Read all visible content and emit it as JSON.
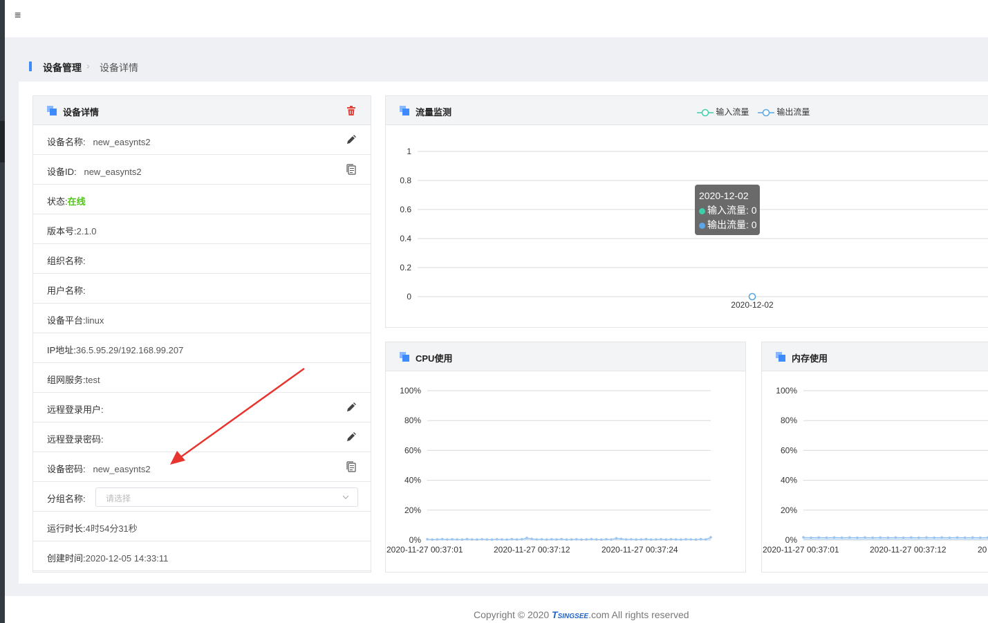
{
  "breadcrumb": {
    "root": "设备管理",
    "current": "设备详情"
  },
  "detail": {
    "title": "设备详情",
    "rows": {
      "name": {
        "label": "设备名称:",
        "value": "new_easynts2"
      },
      "id": {
        "label": "设备ID:",
        "value": "new_easynts2"
      },
      "status": {
        "label": "状态:",
        "value": "在线"
      },
      "version": {
        "label": "版本号:",
        "value": "2.1.0"
      },
      "org": {
        "label": "组织名称:",
        "value": ""
      },
      "user": {
        "label": "用户名称:",
        "value": ""
      },
      "platform": {
        "label": "设备平台:",
        "value": "linux"
      },
      "ip": {
        "label": "IP地址:",
        "value": "36.5.95.29/192.168.99.207"
      },
      "network": {
        "label": "组网服务:",
        "value": "test"
      },
      "remote_user": {
        "label": "远程登录用户:",
        "value": ""
      },
      "remote_pwd": {
        "label": "远程登录密码:",
        "value": ""
      },
      "device_pwd": {
        "label": "设备密码:",
        "value": "new_easynts2"
      },
      "group": {
        "label": "分组名称:",
        "placeholder": "请选择"
      },
      "uptime": {
        "label": "运行时长:",
        "value": "4时54分31秒"
      },
      "created": {
        "label": "创建时间:",
        "value": "2020-12-05 14:33:11"
      }
    }
  },
  "flow": {
    "title": "流量监测",
    "legend_in": "输入流量",
    "legend_out": "输出流量",
    "tooltip": {
      "date": "2020-12-02",
      "in": "输入流量: 0",
      "out": "输出流量: 0"
    }
  },
  "cpu": {
    "title": "CPU使用"
  },
  "mem": {
    "title": "内存使用"
  },
  "footer": {
    "prefix": "Copyright © 2020 ",
    "brand": "Tsingsee",
    "suffix": ".com All rights reserved"
  },
  "colors": {
    "accent": "#3d8bff",
    "online": "#52c41a",
    "delete": "#e0413a",
    "input_series": "#3ecfa8",
    "output_series": "#5aa6e8"
  },
  "chart_data": [
    {
      "type": "line",
      "x": [
        "2020-12-02"
      ],
      "series": [
        {
          "name": "输入流量",
          "values": [
            0
          ]
        },
        {
          "name": "输出流量",
          "values": [
            0
          ]
        }
      ],
      "ylim": [
        0,
        1
      ],
      "yticks": [
        "0",
        "0.2",
        "0.4",
        "0.6",
        "0.8",
        "1"
      ],
      "grid": true,
      "legend": "top"
    },
    {
      "type": "area",
      "xticks": [
        "2020-11-27 00:37:01",
        "2020-11-27 00:37:12",
        "2020-11-27 00:37:24"
      ],
      "values": [
        0.5,
        0.3,
        0.4,
        0.6,
        0.3,
        0.5,
        0.4,
        0.3,
        0.6,
        0.4,
        0.3,
        0.5,
        0.4,
        0.3,
        0.5,
        0.4,
        0.3,
        0.6,
        0.4,
        0.5,
        1.4,
        0.8,
        0.4,
        0.5,
        0.3,
        0.5,
        0.4,
        0.6,
        0.3,
        0.4,
        0.5,
        0.3,
        0.4,
        0.6,
        0.4,
        0.3,
        0.5,
        0.4,
        1.2,
        0.8,
        0.4,
        0.5,
        0.3,
        0.4,
        0.6,
        0.3,
        0.4,
        0.5,
        0.3,
        0.5,
        0.4,
        0.3,
        0.5,
        0.4,
        0.3,
        0.6,
        0.4,
        1.8
      ],
      "ylim": [
        0,
        100
      ],
      "yticks": [
        "0%",
        "20%",
        "40%",
        "60%",
        "80%",
        "100%"
      ],
      "grid": true
    },
    {
      "type": "area",
      "xticks": [
        "2020-11-27 00:37:01",
        "2020-11-27 00:37:12",
        "20"
      ],
      "values": [
        1.8,
        1.6,
        1.7,
        1.6,
        1.7,
        1.6,
        1.7,
        1.6,
        1.7,
        1.6,
        1.7,
        1.6,
        1.7,
        1.6,
        1.7,
        1.6,
        1.7,
        1.6,
        1.7,
        1.6,
        1.7,
        1.6,
        1.7,
        1.6,
        1.7
      ],
      "ylim": [
        0,
        100
      ],
      "yticks": [
        "0%",
        "20%",
        "40%",
        "60%",
        "80%",
        "100%"
      ],
      "grid": true
    }
  ]
}
